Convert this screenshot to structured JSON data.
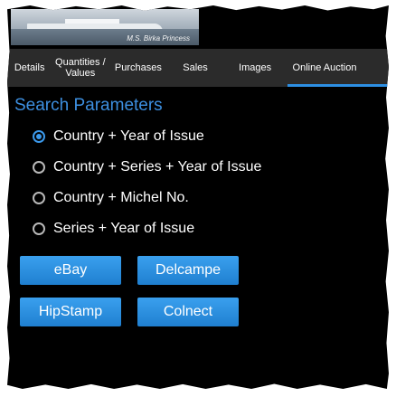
{
  "banner": {
    "caption": "M.S. Birka Princess"
  },
  "tabs": [
    {
      "label": "Details"
    },
    {
      "label": "Quantities / Values"
    },
    {
      "label": "Purchases"
    },
    {
      "label": "Sales"
    },
    {
      "label": "Images"
    },
    {
      "label": "Online Auction",
      "active": true
    }
  ],
  "search": {
    "title": "Search Parameters",
    "options": [
      {
        "label": "Country + Year of Issue",
        "checked": true
      },
      {
        "label": "Country + Series + Year of Issue",
        "checked": false
      },
      {
        "label": "Country + Michel No.",
        "checked": false
      },
      {
        "label": "Series + Year of Issue",
        "checked": false
      }
    ]
  },
  "buttons": {
    "ebay": "eBay",
    "delcampe": "Delcampe",
    "hipstamp": "HipStamp",
    "colnect": "Colnect"
  },
  "colors": {
    "accent": "#2d8fe3",
    "title": "#3d8fe0",
    "tabbar": "#2b2b2b",
    "background": "#000000"
  }
}
